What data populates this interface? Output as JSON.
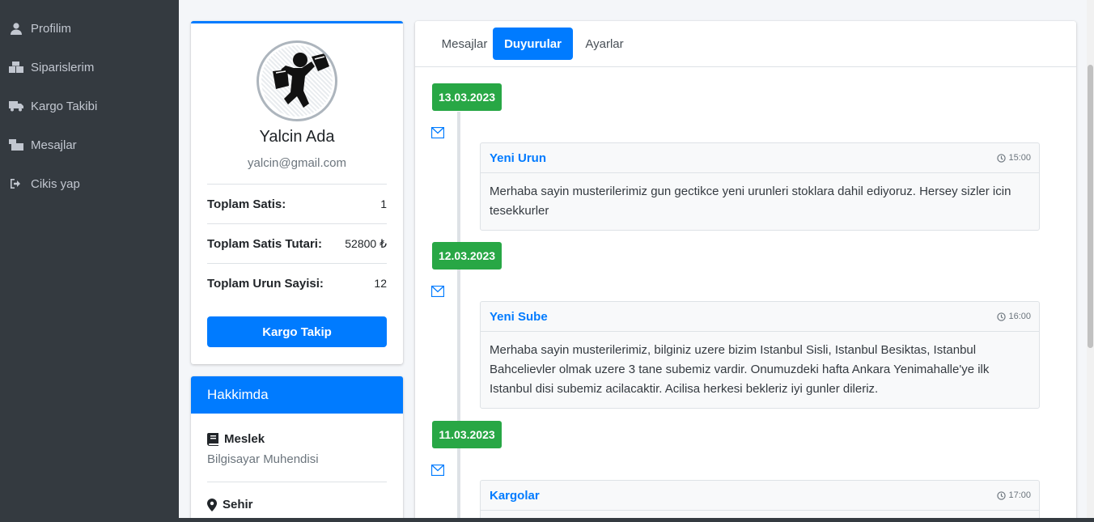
{
  "sidebar": {
    "items": [
      {
        "label": "Profilim",
        "icon": "user-icon"
      },
      {
        "label": "Siparislerim",
        "icon": "boxes-icon"
      },
      {
        "label": "Kargo Takibi",
        "icon": "truck-icon"
      },
      {
        "label": "Mesajlar",
        "icon": "mail-bulk-icon"
      },
      {
        "label": "Cikis yap",
        "icon": "sign-out-icon"
      }
    ]
  },
  "profile": {
    "name": "Yalcin Ada",
    "email": "yalcin@gmail.com",
    "stats": [
      {
        "label": "Toplam Satis:",
        "value": "1"
      },
      {
        "label": "Toplam Satis Tutari:",
        "value": "52800 ₺"
      },
      {
        "label": "Toplam Urun Sayisi:",
        "value": "12"
      }
    ],
    "button_label": "Kargo Takip"
  },
  "about": {
    "title": "Hakkimda",
    "fields": [
      {
        "label": "Meslek",
        "value": "Bilgisayar Muhendisi",
        "icon": "book-icon"
      },
      {
        "label": "Sehir",
        "value": "",
        "icon": "map-marker-icon"
      }
    ]
  },
  "tabs": [
    {
      "label": "Mesajlar",
      "active": false
    },
    {
      "label": "Duyurular",
      "active": true
    },
    {
      "label": "Ayarlar",
      "active": false
    }
  ],
  "timeline": [
    {
      "date": "13.03.2023",
      "title": "Yeni Urun",
      "time": "15:00",
      "body": "Merhaba sayin musterilerimiz gun gectikce yeni urunleri stoklara dahil ediyoruz. Hersey sizler icin tesekkurler"
    },
    {
      "date": "12.03.2023",
      "title": "Yeni Sube",
      "time": "16:00",
      "body": "Merhaba sayin musterilerimiz, bilginiz uzere bizim Istanbul Sisli, Istanbul Besiktas, Istanbul Bahcelievler olmak uzere 3 tane subemiz vardir. Onumuzdeki hafta Ankara Yenimahalle'ye ilk Istanbul disi subemiz acilacaktir. Acilisa herkesi bekleriz iyi gunler dileriz."
    },
    {
      "date": "11.03.2023",
      "title": "Kargolar",
      "time": "17:00",
      "body": ""
    }
  ],
  "colors": {
    "primary": "#007bff",
    "success": "#28a745",
    "sidebar": "#343a40"
  }
}
